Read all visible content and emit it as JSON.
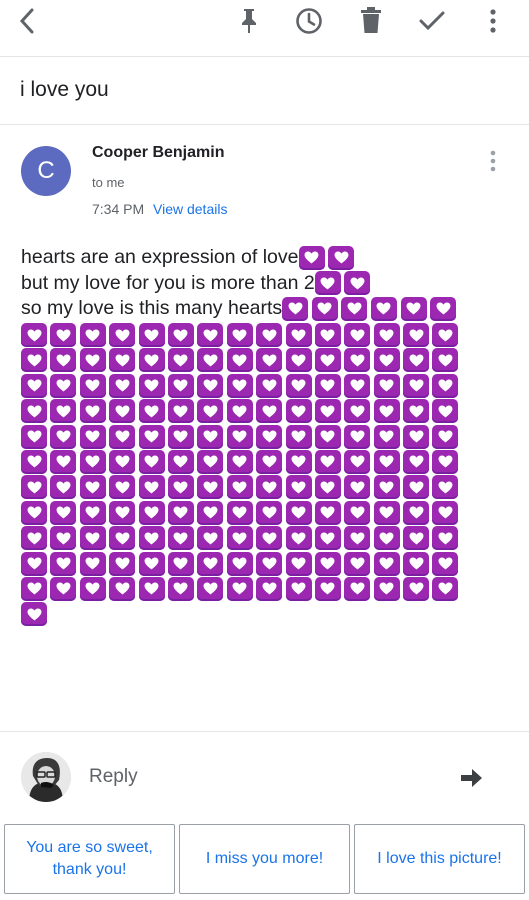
{
  "toolbar": {
    "icons": [
      "back-icon",
      "pin-icon",
      "clock-icon",
      "trash-icon",
      "check-icon",
      "more-icon"
    ]
  },
  "email": {
    "subject": "i love you",
    "sender_initial": "C",
    "sender_name": "Cooper Benjamin",
    "recipient": "to me",
    "time": "7:34 PM",
    "view_details": "View details",
    "lines": [
      {
        "text": "hearts are an expression of love",
        "hearts": 2
      },
      {
        "text": "but my love for you is more than 2",
        "hearts": 2
      },
      {
        "text": "so my love is this many hearts",
        "hearts": 6
      }
    ],
    "grid_heart_count": 166,
    "heart_emoji": "purple-heart-emoji",
    "colors": {
      "heart": "#9c27b0",
      "avatar": "#5c6bc0",
      "link": "#1a73e8"
    }
  },
  "reply": {
    "label": "Reply"
  },
  "smart_replies": [
    {
      "label": "You are so sweet,\nthank you!"
    },
    {
      "label": "I miss you more!"
    },
    {
      "label": "I love this picture!"
    }
  ]
}
